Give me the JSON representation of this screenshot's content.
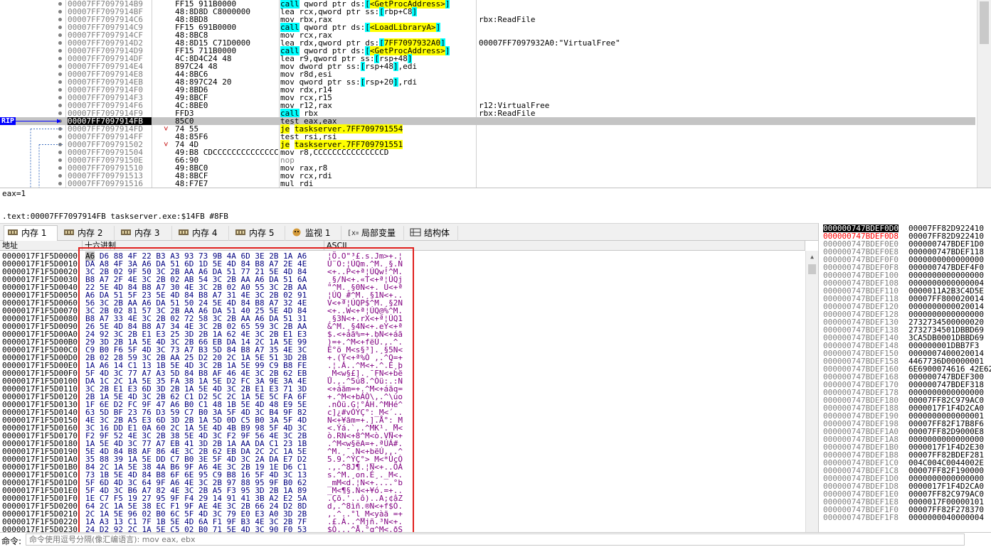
{
  "disasm": {
    "rip_label": "RIP",
    "rows": [
      {
        "addr": "00007FF7097914B9",
        "bytes": "FF15 911B0000",
        "instr": "call qword ptr ds:[<GetProcAddress>]",
        "kind": "call_api",
        "comment": ""
      },
      {
        "addr": "00007FF7097914BF",
        "bytes": "48:8D8D C8000000",
        "instr": "lea rcx,qword ptr ss:[rbp+C8]",
        "kind": "mem",
        "comment": ""
      },
      {
        "addr": "00007FF7097914C6",
        "bytes": "48:8BD8",
        "instr": "mov rbx,rax",
        "kind": "plain",
        "comment": "rbx:ReadFile"
      },
      {
        "addr": "00007FF7097914C9",
        "bytes": "FF15 691B0000",
        "instr": "call qword ptr ds:[<LoadLibraryA>]",
        "kind": "call_api",
        "comment": ""
      },
      {
        "addr": "00007FF7097914CF",
        "bytes": "48:8BC8",
        "instr": "mov rcx,rax",
        "kind": "plain",
        "comment": ""
      },
      {
        "addr": "00007FF7097914D2",
        "bytes": "48:8D15 C71D0000",
        "instr": "lea rdx,qword ptr ds:[7FF7097932A0]",
        "kind": "api_addr",
        "comment": "00007FF7097932A0:\"VirtualFree\""
      },
      {
        "addr": "00007FF7097914D9",
        "bytes": "FF15 711B0000",
        "instr": "call qword ptr ds:[<GetProcAddress>]",
        "kind": "call_api",
        "comment": ""
      },
      {
        "addr": "00007FF7097914DF",
        "bytes": "4C:8D4C24 48",
        "instr": "lea r9,qword ptr ss:[rsp+48]",
        "kind": "mem",
        "comment": ""
      },
      {
        "addr": "00007FF7097914E4",
        "bytes": "897C24 48",
        "instr": "mov dword ptr ss:[rsp+48],edi",
        "kind": "mem",
        "comment": ""
      },
      {
        "addr": "00007FF7097914E8",
        "bytes": "44:8BC6",
        "instr": "mov r8d,esi",
        "kind": "plain",
        "comment": ""
      },
      {
        "addr": "00007FF7097914EB",
        "bytes": "48:897C24 20",
        "instr": "mov qword ptr ss:[rsp+20],rdi",
        "kind": "mem",
        "comment": ""
      },
      {
        "addr": "00007FF7097914F0",
        "bytes": "49:8BD6",
        "instr": "mov rdx,r14",
        "kind": "plain",
        "comment": ""
      },
      {
        "addr": "00007FF7097914F3",
        "bytes": "49:8BCF",
        "instr": "mov rcx,r15",
        "kind": "plain",
        "comment": ""
      },
      {
        "addr": "00007FF7097914F6",
        "bytes": "4C:8BE0",
        "instr": "mov r12,rax",
        "kind": "plain",
        "comment": "r12:VirtualFree"
      },
      {
        "addr": "00007FF7097914F9",
        "bytes": "FFD3",
        "instr": "call rbx",
        "kind": "call_reg",
        "comment": "rbx:ReadFile"
      },
      {
        "addr": "00007FF7097914FB",
        "bytes": "85C0",
        "instr": "test eax,eax",
        "kind": "plain",
        "comment": "",
        "rip": true
      },
      {
        "addr": "00007FF7097914FD",
        "bytes": "74 55",
        "instr": "je taskserver.7FF709791554",
        "kind": "jmp",
        "comment": "",
        "mark": "˅"
      },
      {
        "addr": "00007FF7097914FF",
        "bytes": "48:85F6",
        "instr": "test rsi,rsi",
        "kind": "plain",
        "comment": ""
      },
      {
        "addr": "00007FF709791502",
        "bytes": "74 4D",
        "instr": "je taskserver.7FF709791551",
        "kind": "jmp",
        "comment": "",
        "mark": "˅"
      },
      {
        "addr": "00007FF709791504",
        "bytes": "49:B8 CDCCCCCCCCCCCCCC",
        "instr": "mov r8,CCCCCCCCCCCCCCCD",
        "kind": "plain",
        "comment": ""
      },
      {
        "addr": "00007FF70979150E",
        "bytes": "66:90",
        "instr": "nop",
        "kind": "nop",
        "comment": ""
      },
      {
        "addr": "00007FF709791510",
        "bytes": "49:8BC0",
        "instr": "mov rax,r8",
        "kind": "plain",
        "comment": ""
      },
      {
        "addr": "00007FF709791513",
        "bytes": "48:8BCF",
        "instr": "mov rcx,rdi",
        "kind": "plain",
        "comment": ""
      },
      {
        "addr": "00007FF709791516",
        "bytes": "48:F7E7",
        "instr": "mul rdi",
        "kind": "plain",
        "comment": ""
      }
    ]
  },
  "info": {
    "line1": "eax=1",
    "line2": ".text:00007FF7097914FB taskserver.exe:$14FB #8FB"
  },
  "tabs": [
    {
      "label": "内存 1",
      "icon": "memory-icon"
    },
    {
      "label": "内存 2",
      "icon": "memory-icon"
    },
    {
      "label": "内存 3",
      "icon": "memory-icon"
    },
    {
      "label": "内存 4",
      "icon": "memory-icon"
    },
    {
      "label": "内存 5",
      "icon": "memory-icon"
    },
    {
      "label": "监视 1",
      "icon": "watch-icon"
    },
    {
      "label": "局部变量",
      "icon": "locals-icon"
    },
    {
      "label": "结构体",
      "icon": "struct-icon"
    }
  ],
  "dump": {
    "headers": {
      "address": "地址",
      "hex": "十六进制",
      "ascii": "ASCII"
    },
    "rows": [
      {
        "addr": "0000017F1F5D0000",
        "hex": "A6 D6 88 4F 22 B3 A3 93 73 9B 4A 6D 3E 2B 1A A6",
        "ascii": "¦Ö.O\"³£.s.Jm>+.¦"
      },
      {
        "addr": "0000017F1F5D0010",
        "hex": "DA A8 4F 3A A6 DA 51 6D 1D 5E 4D 84 B8 A7 2E 4E",
        "ascii": "Ú¨O:¦ÚQm.^M.¸§.N"
      },
      {
        "addr": "0000017F1F5D0020",
        "hex": "3C 2B 02 9F 50 3C 2B AA A6 DA 51 77 21 5E 4D 84",
        "ascii": "<+..P<+ª¦ÚQw!^M."
      },
      {
        "addr": "0000017F1F5D0030",
        "hex": "B8 A7 2F 4E 3C 2B 02 AB 54 3C 2B AA A6 DA 51 6A",
        "ascii": "¸§/N<+.«T<+ª¦ÚQj"
      },
      {
        "addr": "0000017F1F5D0040",
        "hex": "22 5E 4D 84 B8 A7 30 4E 3C 2B 02 A0 55 3C 2B AA",
        "ascii": "\"^M.¸§0N<+. U<+ª"
      },
      {
        "addr": "0000017F1F5D0050",
        "hex": "A6 DA 51 5F 23 5E 4D 84 B8 A7 31 4E 3C 2B 02 91",
        "ascii": "¦ÚQ_#^M.¸§1N<+.."
      },
      {
        "addr": "0000017F1F5D0060",
        "hex": "56 3C 2B AA A6 DA 51 50 24 5E 4D 84 B8 A7 32 4E",
        "ascii": "V<+ª¦ÚQP$^M.¸§2N"
      },
      {
        "addr": "0000017F1F5D0070",
        "hex": "3C 2B 02 81 57 3C 2B AA A6 DA 51 40 25 5E 4D 84",
        "ascii": "<+..W<+ª¦ÚQ@%^M."
      },
      {
        "addr": "0000017F1F5D0080",
        "hex": "B8 A7 33 4E 3C 2B 02 72 58 3C 2B AA A6 DA 51 31",
        "ascii": "¸§3N<+.rX<+ª¦ÚQ1"
      },
      {
        "addr": "0000017F1F5D0090",
        "hex": "26 5E 4D 84 B8 A7 34 4E 3C 2B 02 65 59 3C 2B AA",
        "ascii": "&^M.¸§4N<+.eY<+ª"
      },
      {
        "addr": "0000017F1F5D00A0",
        "hex": "24 92 3C 2B E1 E3 25 3D 2B 1A 62 4E 3C 2B E1 E3",
        "ascii": "$.<+áã%=+.bN<+áã"
      },
      {
        "addr": "0000017F1F5D00B0",
        "hex": "29 3D 2B 1A 5E 4D 3C 2B 66 EB DA 14 2C 1A 5E 99",
        "ascii": ")=+.^M<+fëÚ.,.^."
      },
      {
        "addr": "0000017F1F5D00C0",
        "hex": "C9 B0 F6 5F 4D 3C 73 A7 B3 5D 84 B8 A7 35 4E 3C",
        "ascii": "É°ö_M<s§³].¸§5N<"
      },
      {
        "addr": "0000017F1F5D00D0",
        "hex": "2B 02 28 59 3C 2B AA 25 D2 20 2C 1A 5E 51 3D 2B",
        "ascii": "+.(Y<+ª%Ò ,.^Q=+"
      },
      {
        "addr": "0000017F1F5D00E0",
        "hex": "1A A6 14 C1 13 1B 5E 4D 3C 2B 1A 5E 99 C9 B8 FE",
        "ascii": ".¦.Á..^M<+.^.É¸þ"
      },
      {
        "addr": "0000017F1F5D00F0",
        "hex": "5F 4D 3C 77 A7 A3 5D 84 B8 AF 46 4E 3C 2B 62 EB",
        "ascii": "_M<w§£].¸¯FN<+bë"
      },
      {
        "addr": "0000017F1F5D0100",
        "hex": "DA 1C 2C 1A 5E 35 FA 38 1A 5E D2 FC 3A 9E 3A 4E",
        "ascii": "Ú.,.^5ú8.^Òü:.:N"
      },
      {
        "addr": "0000017F1F5D0110",
        "hex": "3C 2B E1 E3 6D 3D 2B 1A 5E 4D 3C 2B E1 E3 71 3D",
        "ascii": "<+áãm=+.^M<+áãq="
      },
      {
        "addr": "0000017F1F5D0120",
        "hex": "2B 1A 5E 4D 3C 2B 62 C1 D2 5C 2C 1A 5E 5C FA 6F",
        "ascii": "+.^M<+bÁÒ\\,.^\\úo"
      },
      {
        "addr": "0000017F1F5D0130",
        "hex": "1F 6E D2 FC 9F 47 A6 B0 C1 48 1B 5E 4D 48 E9 5E",
        "ascii": ".nÒü.G¦°ÁH.^MHé^"
      },
      {
        "addr": "0000017F1F5D0140",
        "hex": "63 5D BF 23 76 D3 59 C7 B0 3A 5F 4D 3C B4 9F 82",
        "ascii": "c]¿#vÓYÇ°:_M<´.."
      },
      {
        "addr": "0000017F1F5D0150",
        "hex": "4E 3C 2B A5 E3 6D 3D 2B 1A 5D 0D C5 B0 3A 5F 4D",
        "ascii": "N<+¥ãm=+.].Å°:_M"
      },
      {
        "addr": "0000017F1F5D0160",
        "hex": "3C 16 DD E1 0A 60 2C 1A 5E 4D 4B B9 98 5F 4D 3C",
        "ascii": "<.Ýá.`,.^MK¹._M<"
      },
      {
        "addr": "0000017F1F5D0170",
        "hex": "F2 9F 52 4E 3C 2B 38 5E 4D 3C F2 9F 56 4E 3C 2B",
        "ascii": "ò.RN<+8^M<ò.VN<+"
      },
      {
        "addr": "0000017F1F5D0180",
        "hex": "1A 5E 4D 3C 77 A7 EB 41 3D 2B 1A AA DA C1 23 1B",
        "ascii": ".^M<w§ëA=+.ªÚÁ#."
      },
      {
        "addr": "0000017F1F5D0190",
        "hex": "5E 4D 84 B8 AF 86 4E 3C 2B 62 EB DA 2C 2C 1A 5E",
        "ascii": "^M.¸¯.N<+bëÚ,,.^"
      },
      {
        "addr": "0000017F1F5D01A0",
        "hex": "35 88 39 1A 5E DD C7 B0 3E 5F 4D 3C 2A DA E7 D2",
        "ascii": "5.9.^ÝÇ°>_M<*ÚçÒ"
      },
      {
        "addr": "0000017F1F5D01B0",
        "hex": "84 2C 1A 5E 38 4A B6 9F A6 4E 3C 2B 19 1E D6 C1",
        "ascii": ".,.^8J¶.¦N<+..ÖÁ"
      },
      {
        "addr": "0000017F1F5D01C0",
        "hex": "73 1B 5E 4D 84 B8 6F 6E 95 C9 B8 16 5F 4D 3C 13",
        "ascii": "s.^M.¸on.É¸._M<."
      },
      {
        "addr": "0000017F1F5D01D0",
        "hex": "5F 6D 4D 3C 64 9F A6 4E 3C 2B 97 88 95 9F B0 62",
        "ascii": "_mM<d.¦N<+....°b"
      },
      {
        "addr": "0000017F1F5D01E0",
        "hex": "5F 4D 3C B6 A7 82 4E 3C 2B A5 F3 95 3D 2B 1A 89",
        "ascii": "_M<¶§.N<+¥ó.=+.."
      },
      {
        "addr": "0000017F1F5D01F0",
        "hex": "1E C7 F5 19 27 95 9F F4 29 14 91 41 3B A2 E2 5A",
        "ascii": ".Çõ.'..ô)..A;¢âZ"
      },
      {
        "addr": "0000017F1F5D0200",
        "hex": "64 2C 1A 5E 38 EC F1 9F AE 4E 3C 2B 66 24 D2 8D",
        "ascii": "d,.^8ìñ.®N<+f$Ò."
      },
      {
        "addr": "0000017F1F5D0210",
        "hex": "2C 1A 5E 96 02 B0 6C 5F 4D 3C 79 E0 E3 A0 3D 2B",
        "ascii": ",.^..°l_M<yàã =+"
      },
      {
        "addr": "0000017F1F5D0220",
        "hex": "1A A3 13 C1 7F 1B 5E 4D 6A F1 9F B3 4E 3C 2B 7F",
        "ascii": ".£.Á..^Mjñ.³N<+."
      },
      {
        "addr": "0000017F1F5D0230",
        "hex": "24 D2 92 2C 1A 5E C5 02 B0 71 5E 4D 3C 90 F0 53",
        "ascii": "$Ò.,.^Å.°q^M<.ðS"
      }
    ]
  },
  "stack": {
    "rows": [
      {
        "addr": "000000747BDEF0D0",
        "val": "00007FF82D922410",
        "state": "sel"
      },
      {
        "addr": "000000747BDEF0D8",
        "val": "00007FF82D922410",
        "state": "cur"
      },
      {
        "addr": "000000747BDEF0E0",
        "val": "000000747BDEF1D0",
        "state": ""
      },
      {
        "addr": "000000747BDEF0E8",
        "val": "000000747BDEF118",
        "state": ""
      },
      {
        "addr": "000000747BDEF0F0",
        "val": "0000000000000000",
        "state": ""
      },
      {
        "addr": "000000747BDEF0F8",
        "val": "000000747BDEF4F0",
        "state": ""
      },
      {
        "addr": "000000747BDEF100",
        "val": "0000000000000000",
        "state": ""
      },
      {
        "addr": "000000747BDEF108",
        "val": "0000000000000004",
        "state": ""
      },
      {
        "addr": "000000747BDEF110",
        "val": "0000011A2B3C4D5E",
        "state": ""
      },
      {
        "addr": "000000747BDEF118",
        "val": "00007FF800020014",
        "state": ""
      },
      {
        "addr": "000000747BDEF120",
        "val": "0000000000020014",
        "state": ""
      },
      {
        "addr": "000000747BDEF128",
        "val": "0000000000000000",
        "state": ""
      },
      {
        "addr": "000000747BDEF130",
        "val": "2732734500000020",
        "state": ""
      },
      {
        "addr": "000000747BDEF138",
        "val": "2732734501DBBD69",
        "state": ""
      },
      {
        "addr": "000000747BDEF140",
        "val": "3CA5DB0001DBBD69",
        "state": ""
      },
      {
        "addr": "000000747BDEF148",
        "val": "000000001DBB7F3",
        "state": ""
      },
      {
        "addr": "000000747BDEF150",
        "val": "0000007400020014",
        "state": ""
      },
      {
        "addr": "000000747BDEF158",
        "val": "4467736D00000001",
        "state": ""
      },
      {
        "addr": "000000747BDEF160",
        "val": "6E6900074616 42E62",
        "state": ""
      },
      {
        "addr": "000000747BDEF168",
        "val": "000000747BDEF300",
        "state": ""
      },
      {
        "addr": "000000747BDEF170",
        "val": "000000747BDEF318",
        "state": ""
      },
      {
        "addr": "000000747BDEF178",
        "val": "0000000000000000",
        "state": ""
      },
      {
        "addr": "000000747BDEF180",
        "val": "00007FF82C979AC0",
        "state": ""
      },
      {
        "addr": "000000747BDEF188",
        "val": "0000017F1F4D2CA0",
        "state": ""
      },
      {
        "addr": "000000747BDEF190",
        "val": "0000000000000001",
        "state": ""
      },
      {
        "addr": "000000747BDEF198",
        "val": "00007FF82F17B8F6",
        "state": ""
      },
      {
        "addr": "000000747BDEF1A0",
        "val": "00007FF82D9000E8",
        "state": ""
      },
      {
        "addr": "000000747BDEF1A8",
        "val": "0000000000000000",
        "state": ""
      },
      {
        "addr": "000000747BDEF1B0",
        "val": "0000017F1F4D2E30",
        "state": ""
      },
      {
        "addr": "000000747BDEF1B8",
        "val": "00007FF82BDEF281",
        "state": ""
      },
      {
        "addr": "000000747BDEF1C0",
        "val": "004C004C0044002E",
        "state": ""
      },
      {
        "addr": "000000747BDEF1C8",
        "val": "00007FF82F190000",
        "state": ""
      },
      {
        "addr": "000000747BDEF1D0",
        "val": "0000000000000000",
        "state": ""
      },
      {
        "addr": "000000747BDEF1D8",
        "val": "0000017F1F4D2CA0",
        "state": ""
      },
      {
        "addr": "000000747BDEF1E0",
        "val": "00007FF82C979AC0",
        "state": ""
      },
      {
        "addr": "000000747BDEF1E8",
        "val": "0000017F00000101",
        "state": ""
      },
      {
        "addr": "000000747BDEF1F0",
        "val": "00007FF82F278370",
        "state": ""
      },
      {
        "addr": "000000747BDEF1F8",
        "val": "0000000040000004",
        "state": ""
      }
    ]
  },
  "command": {
    "label": "命令:",
    "placeholder": "命令使用逗号分隔(像汇编语言): mov eax, ebx"
  }
}
